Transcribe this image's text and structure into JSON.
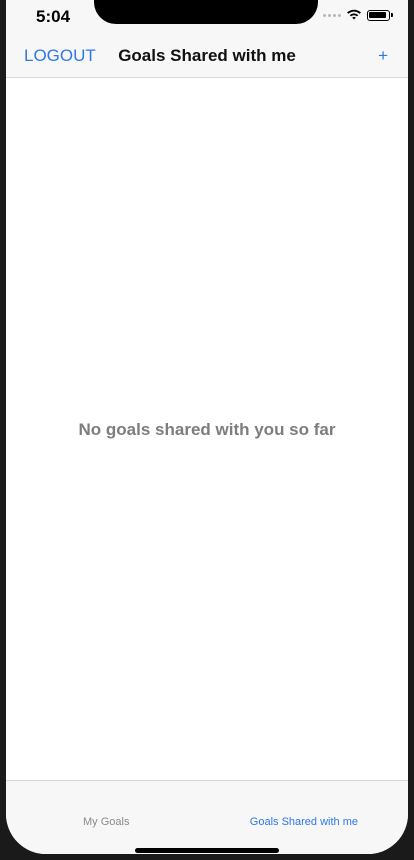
{
  "status_bar": {
    "time": "5:04"
  },
  "nav": {
    "left_label": "LOGOUT",
    "title": "Goals Shared with me",
    "right_label": "+"
  },
  "content": {
    "empty_message": "No goals shared with you so far"
  },
  "tabs": [
    {
      "label": "My Goals"
    },
    {
      "label": "Goals Shared with me"
    }
  ],
  "colors": {
    "accent": "#2f78e6",
    "inactive": "#8a8a8a",
    "empty_text": "#7d7d7d"
  }
}
